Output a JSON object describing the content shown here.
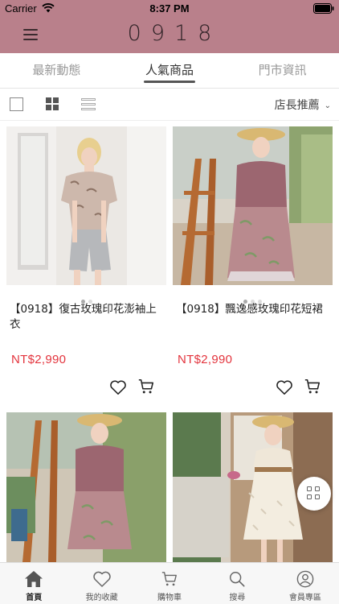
{
  "status_bar": {
    "carrier": "Carrier",
    "time": "8:37 PM"
  },
  "header": {
    "logo": "0918",
    "menu_icon": "hamburger-menu-icon"
  },
  "tabs": [
    {
      "label": "最新動態",
      "active": false
    },
    {
      "label": "人氣商品",
      "active": true
    },
    {
      "label": "門市資訊",
      "active": false
    }
  ],
  "toolbar": {
    "sort_label": "店長推薦",
    "view_modes": [
      "single-view-icon",
      "grid-view-icon",
      "list-view-icon"
    ],
    "selected_view": "grid"
  },
  "products": [
    {
      "name": "【0918】復古玫瑰印花澎袖上衣",
      "price": "NT$2,990"
    },
    {
      "name": "【0918】飄逸感玫瑰印花短裙",
      "price": "NT$2,990"
    },
    {
      "name": "",
      "price": ""
    },
    {
      "name": "",
      "price": ""
    }
  ],
  "bottom_nav": [
    {
      "label": "首頁",
      "icon": "home-icon",
      "active": true
    },
    {
      "label": "我的收藏",
      "icon": "heart-icon",
      "active": false
    },
    {
      "label": "購物車",
      "icon": "cart-icon",
      "active": false
    },
    {
      "label": "搜尋",
      "icon": "search-icon",
      "active": false
    },
    {
      "label": "會員專區",
      "icon": "user-icon",
      "active": false
    }
  ],
  "colors": {
    "header_bg": "#b9808b",
    "price": "#e3343d",
    "active_tab_underline": "#555555"
  }
}
